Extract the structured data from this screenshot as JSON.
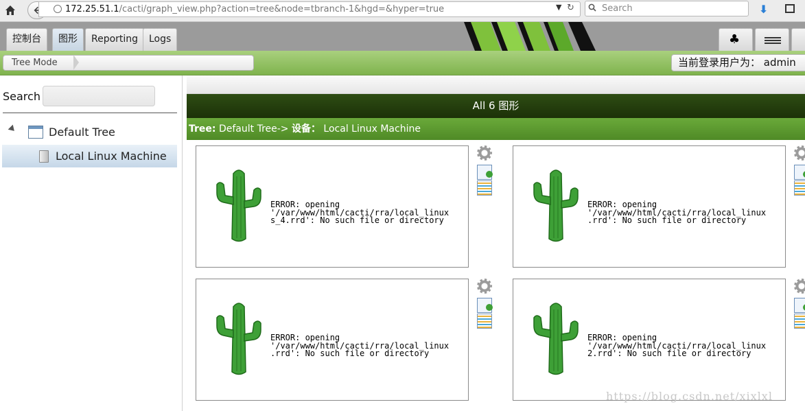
{
  "browser": {
    "url_host": "172.25.51.1",
    "url_path": "/cacti/graph_view.php?action=tree&node=tbranch-1&hgd=&hyper=true",
    "search_placeholder": "Search"
  },
  "tabs": [
    {
      "label": "控制台",
      "active": false
    },
    {
      "label": "图形",
      "active": true
    },
    {
      "label": "Reporting",
      "active": false
    },
    {
      "label": "Logs",
      "active": false
    }
  ],
  "breadcrumb": "Tree Mode",
  "user": {
    "label": "当前登录用户为：",
    "name": "admin"
  },
  "sidebar": {
    "search_label": "Search",
    "tree_root": "Default Tree",
    "tree_leaf": "Local Linux Machine"
  },
  "main": {
    "title": "All 6 图形",
    "tree_prefix": "Tree:",
    "tree_path": " Default Tree-> ",
    "device_label": "设备：",
    "device_name": " Local Linux Machine"
  },
  "graphs": [
    {
      "error": "ERROR: opening\n'/var/www/html/cacti/rra/local_linux\ns_4.rrd': No such file or directory"
    },
    {
      "error": "ERROR: opening\n'/var/www/html/cacti/rra/local_linux\n.rrd': No such file or directory"
    },
    {
      "error": "ERROR: opening\n'/var/www/html/cacti/rra/local_linux\n.rrd': No such file or directory"
    },
    {
      "error": "ERROR: opening\n'/var/www/html/cacti/rra/local_linux\n2.rrd': No such file or directory"
    }
  ],
  "watermark": "https://blog.csdn.net/xixlxl",
  "colors": {
    "header_green": "#7fb34d",
    "title_dark_green": "#2e4d13",
    "tree_bar_green": "#5a962e",
    "cactus_green": "#3ea037"
  }
}
